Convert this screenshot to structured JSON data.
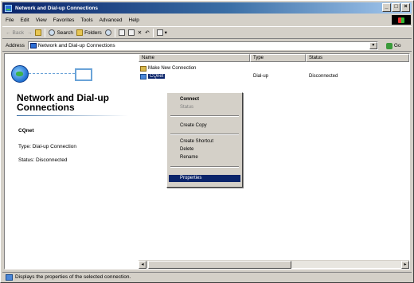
{
  "window": {
    "title": "Network and Dial-up Connections"
  },
  "title_buttons": {
    "minimize": "_",
    "maximize": "□",
    "close": "×"
  },
  "menu": [
    "File",
    "Edit",
    "View",
    "Favorites",
    "Tools",
    "Advanced",
    "Help"
  ],
  "toolbar": {
    "back": "Back",
    "forward": "→",
    "up": "",
    "search": "Search",
    "folders": "Folders",
    "views": ""
  },
  "address": {
    "label": "Address",
    "value": "Network and Dial-up Connections",
    "go": "Go"
  },
  "left_pane": {
    "title": "Network and Dial-up Connections",
    "connection_name": "CQnet",
    "type_text": "Type: Dial-up Connection",
    "status_text": "Status: Disconnected"
  },
  "list": {
    "columns": {
      "name": "Name",
      "type": "Type",
      "status": "Status"
    },
    "items": [
      {
        "name": "Make New Connection",
        "type": "",
        "status": ""
      },
      {
        "name": "CQnet",
        "type": "Dial-up",
        "status": "Disconnected"
      }
    ]
  },
  "context_menu": {
    "items": [
      {
        "label": "Connect"
      },
      {
        "label": "Status"
      },
      {
        "label": "Create Copy"
      },
      {
        "label": "Create Shortcut"
      },
      {
        "label": "Delete"
      },
      {
        "label": "Rename"
      },
      {
        "label": "Properties"
      }
    ]
  },
  "status_bar": {
    "text": "Displays the properties of the selected connection."
  }
}
